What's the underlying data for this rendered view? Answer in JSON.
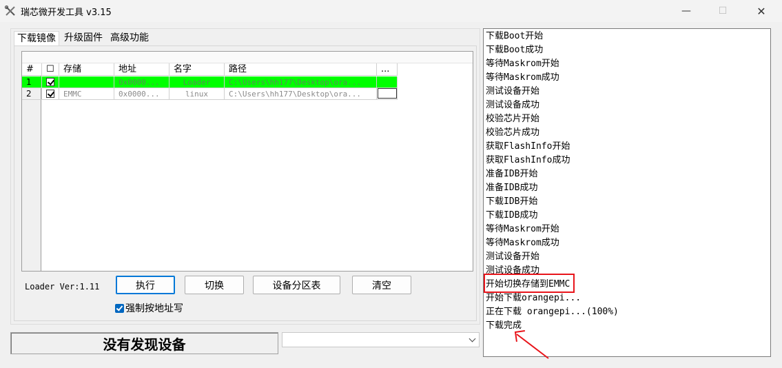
{
  "window": {
    "title": "瑞芯微开发工具 v3.15",
    "app_icon": "tools-icon",
    "minimize_glyph": "—",
    "maximize_glyph": "☐",
    "close_glyph": "✕"
  },
  "tabs": [
    {
      "label": "下载镜像",
      "active": true
    },
    {
      "label": "升级固件",
      "active": false
    },
    {
      "label": "高级功能",
      "active": false
    }
  ],
  "table": {
    "headers": {
      "index": "#",
      "check": "☐",
      "storage": "存储",
      "address": "地址",
      "name": "名字",
      "path": "路径",
      "more": "..."
    },
    "rows": [
      {
        "index": "1",
        "checked": true,
        "storage": "",
        "address": "0x0000...",
        "name": "Loader",
        "path": "C:\\Users\\hh177\\Desktop\\ora...",
        "highlight": "#00ff00"
      },
      {
        "index": "2",
        "checked": true,
        "storage": "EMMC",
        "address": "0x0000...",
        "name": "linux",
        "path": "C:\\Users\\hh177\\Desktop\\ora..."
      }
    ]
  },
  "loader_version": "Loader Ver:1.11",
  "buttons": {
    "run": "执行",
    "switch": "切换",
    "partition_table": "设备分区表",
    "clear": "清空"
  },
  "force_address_write": {
    "label": "强制按地址写",
    "checked": true
  },
  "status_text": "没有发现设备",
  "device_select_value": "",
  "log_lines": [
    "下载Boot开始",
    "下载Boot成功",
    "等待Maskrom开始",
    "等待Maskrom成功",
    "测试设备开始",
    "测试设备成功",
    "校验芯片开始",
    "校验芯片成功",
    "获取FlashInfo开始",
    "获取FlashInfo成功",
    "准备IDB开始",
    "准备IDB成功",
    "下载IDB开始",
    "下载IDB成功",
    "等待Maskrom开始",
    "等待Maskrom成功",
    "测试设备开始",
    "测试设备成功",
    "开始切换存储到EMMC",
    "开始下载orangepi...",
    "正在下载 orangepi...(100%)",
    "下载完成"
  ],
  "annotation_color": "#e8141a"
}
